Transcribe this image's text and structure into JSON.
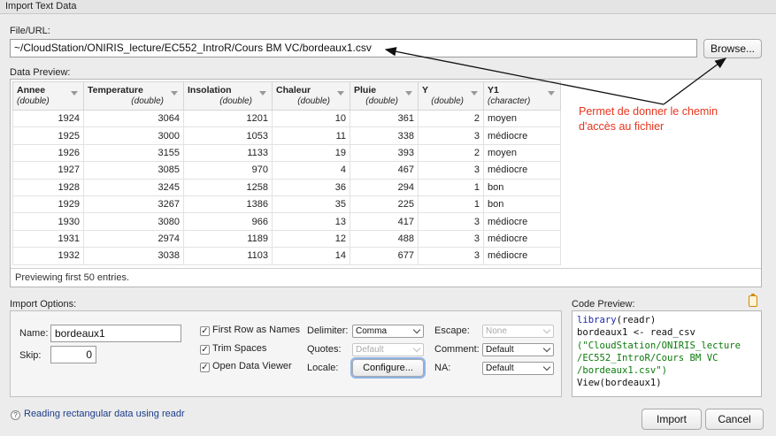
{
  "window": {
    "title": "Import Text Data"
  },
  "file": {
    "label": "File/URL:",
    "value": "~/CloudStation/ONIRIS_lecture/EC552_IntroR/Cours BM VC/bordeaux1.csv",
    "browse_label": "Browse..."
  },
  "preview": {
    "label": "Data Preview:",
    "columns": [
      {
        "name": "Annee",
        "type": "(double)"
      },
      {
        "name": "Temperature",
        "type": "(double)"
      },
      {
        "name": "Insolation",
        "type": "(double)"
      },
      {
        "name": "Chaleur",
        "type": "(double)"
      },
      {
        "name": "Pluie",
        "type": "(double)"
      },
      {
        "name": "Y",
        "type": "(double)"
      },
      {
        "name": "Y1",
        "type": "(character)"
      }
    ],
    "rows": [
      [
        "1924",
        "3064",
        "1201",
        "10",
        "361",
        "2",
        "moyen"
      ],
      [
        "1925",
        "3000",
        "1053",
        "11",
        "338",
        "3",
        "médiocre"
      ],
      [
        "1926",
        "3155",
        "1133",
        "19",
        "393",
        "2",
        "moyen"
      ],
      [
        "1927",
        "3085",
        "970",
        "4",
        "467",
        "3",
        "médiocre"
      ],
      [
        "1928",
        "3245",
        "1258",
        "36",
        "294",
        "1",
        "bon"
      ],
      [
        "1929",
        "3267",
        "1386",
        "35",
        "225",
        "1",
        "bon"
      ],
      [
        "1930",
        "3080",
        "966",
        "13",
        "417",
        "3",
        "médiocre"
      ],
      [
        "1931",
        "2974",
        "1189",
        "12",
        "488",
        "3",
        "médiocre"
      ],
      [
        "1932",
        "3038",
        "1103",
        "14",
        "677",
        "3",
        "médiocre"
      ]
    ],
    "footer": "Previewing first 50 entries."
  },
  "annotation": {
    "line1": "Permet de donner le chemin",
    "line2": "d'accès au fichier",
    "color": "#e8341c"
  },
  "import_options": {
    "label": "Import Options:",
    "name_label": "Name:",
    "name_value": "bordeaux1",
    "skip_label": "Skip:",
    "skip_value": "0",
    "first_row_label": "First Row as Names",
    "trim_spaces_label": "Trim Spaces",
    "open_viewer_label": "Open Data Viewer",
    "check_mark": "✓",
    "delimiter_label": "Delimiter:",
    "delimiter_value": "Comma",
    "quotes_label": "Quotes:",
    "quotes_value": "Default",
    "locale_label": "Locale:",
    "configure_label": "Configure...",
    "escape_label": "Escape:",
    "escape_value": "None",
    "comment_label": "Comment:",
    "comment_value": "Default",
    "na_label": "NA:",
    "na_value": "Default"
  },
  "code_preview": {
    "label": "Code Preview:",
    "line1_kw": "library",
    "line1_rest": "(readr)",
    "line2": "bordeaux1 <- read_csv",
    "line3": "(\"CloudStation/ONIRIS_lecture",
    "line4": "/EC552_IntroR/Cours BM VC",
    "line5": "/bordeaux1.csv\")",
    "line6": "View(bordeaux1)"
  },
  "footer": {
    "help_icon": "?",
    "help_link": "Reading rectangular data using readr",
    "import_label": "Import",
    "cancel_label": "Cancel"
  }
}
